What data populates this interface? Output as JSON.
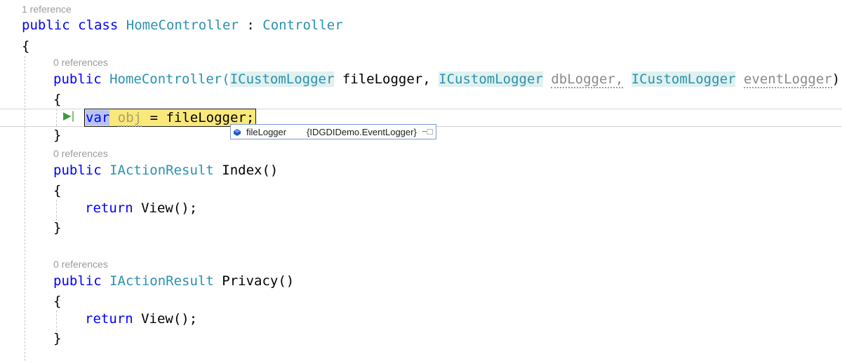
{
  "codelens": {
    "class_refs": "1 reference",
    "ctor_refs": "0 references",
    "index_refs": "0 references",
    "privacy_refs": "0 references"
  },
  "code": {
    "class_kw1": "public",
    "class_kw2": "class",
    "class_name": "HomeController",
    "colon": ":",
    "base_type": "Controller",
    "open_brace": "{",
    "close_brace": "}",
    "ctor_public": "public",
    "ctor_name": "HomeController(",
    "type1": "ICustomLogger",
    "param1": "fileLogger,",
    "type2": "ICustomLogger",
    "param2": "dbLogger,",
    "type3": "ICustomLogger",
    "param3": "eventLogger",
    "close_paren": ")",
    "stmt_var": "var",
    "stmt_obj": "obj",
    "stmt_rest": "= fileLogger;",
    "index_public": "public",
    "index_type": "IActionResult",
    "index_name": "Index()",
    "return_kw": "return",
    "return_expr": "View();",
    "privacy_public": "public",
    "privacy_type": "IActionResult",
    "privacy_name": "Privacy()"
  },
  "datatip": {
    "name": "fileLogger",
    "value": "{IDGDIDemo.EventLogger}",
    "pin_icon": "pin-icon",
    "type_icon": "field-icon"
  },
  "gutter": {
    "icon": "run-to-click-icon"
  },
  "colors": {
    "keyword": "#0000ff",
    "type": "#2b91af",
    "codelens": "#9b9b9b",
    "statement_highlight": "#fbe87a"
  }
}
